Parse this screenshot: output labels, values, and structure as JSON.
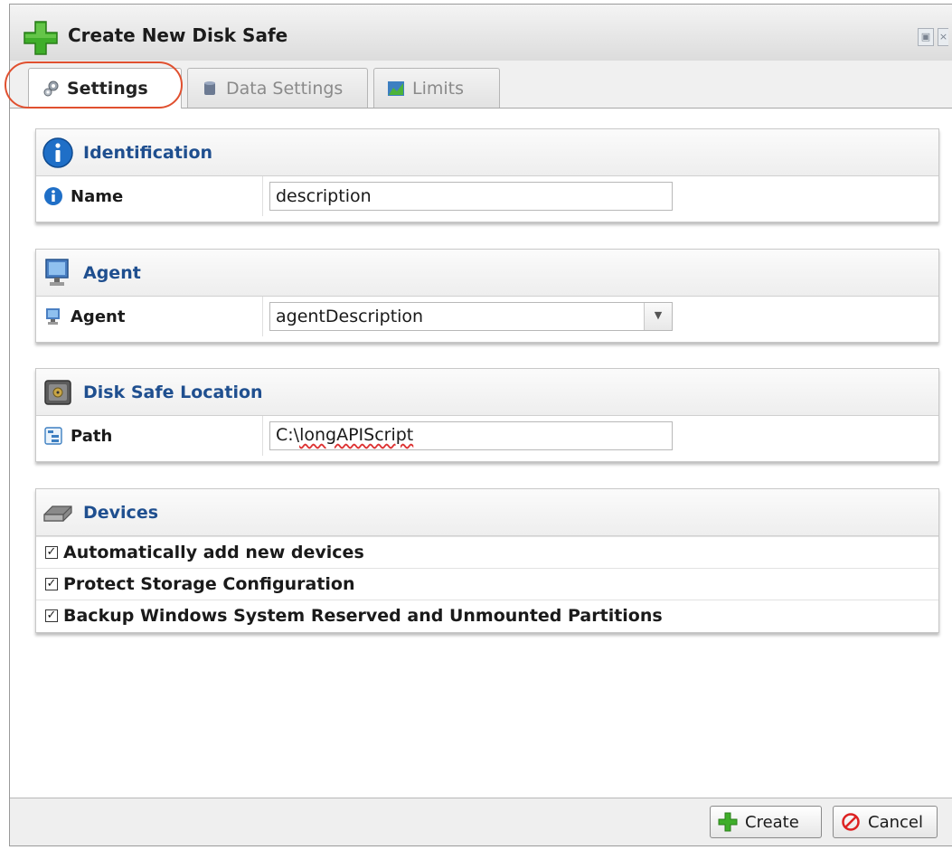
{
  "dialog": {
    "title": "Create New Disk Safe",
    "title_icon": "green-plus-icon"
  },
  "tabs": [
    {
      "label": "Settings",
      "icon": "gears-icon",
      "active": true
    },
    {
      "label": "Data Settings",
      "icon": "database-icon",
      "active": false
    },
    {
      "label": "Limits",
      "icon": "chart-icon",
      "active": false
    }
  ],
  "sections": {
    "identification": {
      "title": "Identification",
      "name_label": "Name",
      "name_value": "description"
    },
    "agent": {
      "title": "Agent",
      "agent_label": "Agent",
      "agent_value": "agentDescription"
    },
    "location": {
      "title": "Disk Safe Location",
      "path_label": "Path",
      "path_prefix": "C:\\",
      "path_rest": "longAPIScript"
    },
    "devices": {
      "title": "Devices",
      "options": [
        {
          "label": "Automatically add new devices",
          "checked": true
        },
        {
          "label": "Protect Storage Configuration",
          "checked": true
        },
        {
          "label": "Backup Windows System Reserved and Unmounted Partitions",
          "checked": true
        }
      ]
    }
  },
  "footer": {
    "create_label": "Create",
    "cancel_label": "Cancel"
  },
  "colors": {
    "section_title": "#1f4f8f",
    "highlight": "#e0502f"
  }
}
